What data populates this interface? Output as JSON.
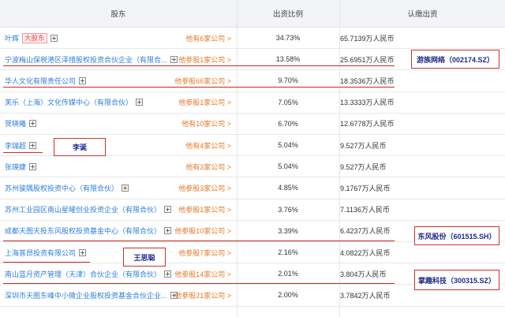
{
  "header": {
    "col1": "股东",
    "col2": "出资比例",
    "col3": "认缴出资"
  },
  "rows": [
    {
      "name": "叶辉",
      "tag": "大股东",
      "other": "他有6家公司 >",
      "ratio": "34.73%",
      "amount": "65.7139万人民币"
    },
    {
      "name": "宁波梅山保税港区泽措股权投资合伙企业（有限合...",
      "tag": "",
      "other": "他参股1家公司 >",
      "ratio": "13.58%",
      "amount": "25.6951万人民币"
    },
    {
      "name": "华人文化有限责任公司",
      "tag": "",
      "other": "他参股66家公司 >",
      "ratio": "9.70%",
      "amount": "18.3536万人民币"
    },
    {
      "name": "芙乐（上海）文化传媒中心（有限合伙）",
      "tag": "",
      "other": "他参股1家公司 >",
      "ratio": "7.05%",
      "amount": "13.3333万人民币"
    },
    {
      "name": "贺晓曦",
      "tag": "",
      "other": "他有10家公司 >",
      "ratio": "6.70%",
      "amount": "12.6778万人民币"
    },
    {
      "name": "李瑞超",
      "tag": "",
      "other": "他有4家公司 >",
      "ratio": "5.04%",
      "amount": "9.527万人民币"
    },
    {
      "name": "张瑛婕",
      "tag": "",
      "other": "他有3家公司 >",
      "ratio": "5.04%",
      "amount": "9.527万人民币"
    },
    {
      "name": "苏州骏隅股权投资中心（有限合伙）",
      "tag": "",
      "other": "他参股3家公司 >",
      "ratio": "4.85%",
      "amount": "9.1767万人民币"
    },
    {
      "name": "苏州工业园区南山星曜创业投资企业（有限合伙）",
      "tag": "",
      "other": "他参股1家公司 >",
      "ratio": "3.76%",
      "amount": "7.1136万人民币"
    },
    {
      "name": "成都天图天投东风股权投资基金中心（有限合伙）",
      "tag": "",
      "other": "他参股10家公司 >",
      "ratio": "3.39%",
      "amount": "6.4237万人民币"
    },
    {
      "name": "上海普昂投资有限公司",
      "tag": "",
      "other": "他参股7家公司 >",
      "ratio": "2.16%",
      "amount": "4.0822万人民币"
    },
    {
      "name": "南山蓝月资产管理（天津）合伙企业（有限合伙）",
      "tag": "",
      "other": "他参股14家公司 >",
      "ratio": "2.01%",
      "amount": "3.804万人民币"
    },
    {
      "name": "深圳市天图东峰中小微企业股权投资基金合伙企业...",
      "tag": "",
      "other": "他参股21家公司 >",
      "ratio": "2.00%",
      "amount": "3.7842万人民币"
    }
  ],
  "annotations": {
    "youzu": "游族网络（002174.SZ）",
    "lidan": "李诞",
    "dongfeng": "东风股份（601515.SH）",
    "wangsicong": "王思聪",
    "zhangqu": "掌趣科技（300315.SZ）"
  },
  "colors": {
    "link": "#2d7fd8",
    "other": "#e07a2a",
    "highlight": "#d4261f",
    "annotation_text": "#1e2a8a"
  }
}
